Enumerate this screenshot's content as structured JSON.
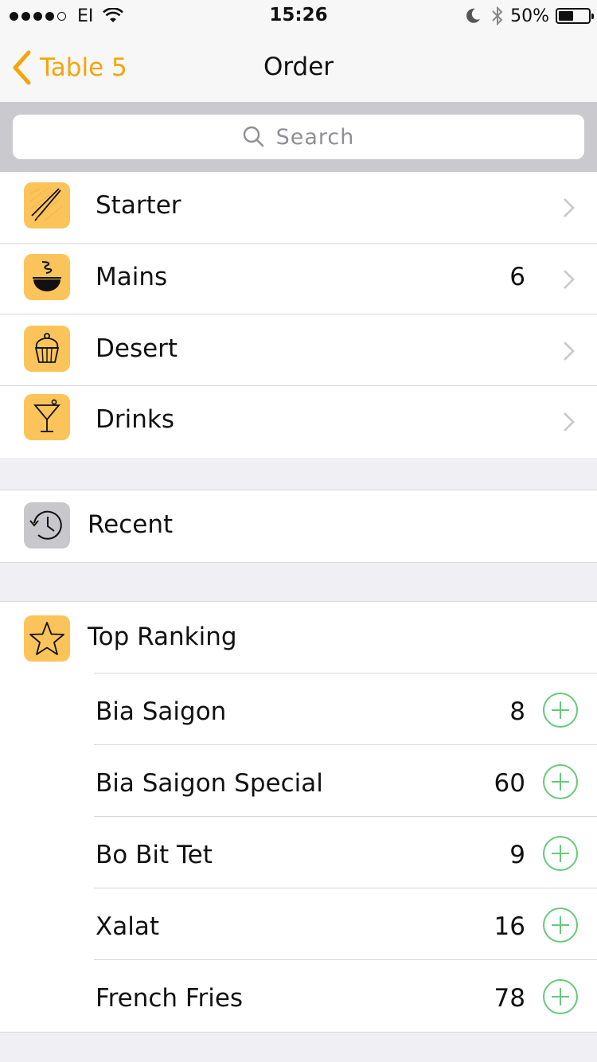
{
  "status": {
    "carrier": "EI",
    "time": "15:26",
    "battery": "50%",
    "battery_level": 0.5
  },
  "nav": {
    "back_label": "Table 5",
    "title": "Order"
  },
  "search": {
    "placeholder": "Search"
  },
  "categories": [
    {
      "label": "Starter",
      "count": "",
      "icon": "chopsticks-icon"
    },
    {
      "label": "Mains",
      "count": "6",
      "icon": "bowl-icon"
    },
    {
      "label": "Desert",
      "count": "",
      "icon": "cupcake-icon"
    },
    {
      "label": "Drinks",
      "count": "",
      "icon": "cocktail-icon"
    }
  ],
  "recent": {
    "label": "Recent",
    "icon": "history-icon"
  },
  "top_ranking": {
    "label": "Top Ranking",
    "icon": "star-icon",
    "items": [
      {
        "name": "Bia Saigon",
        "count": "8"
      },
      {
        "name": "Bia Saigon Special",
        "count": "60"
      },
      {
        "name": "Bo Bit Tet",
        "count": "9"
      },
      {
        "name": "Xalat",
        "count": "16"
      },
      {
        "name": "French Fries",
        "count": "78"
      }
    ]
  },
  "colors": {
    "accent": "#f5a40a",
    "icon_bg": "#fbc45a",
    "add_green": "#67c87b",
    "background": "#efeff4"
  }
}
